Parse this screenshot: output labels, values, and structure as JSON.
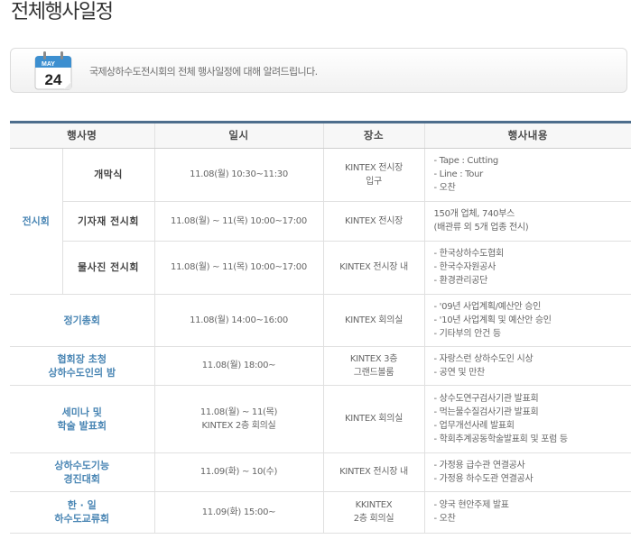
{
  "page": {
    "title": "전체행사일정"
  },
  "notice": {
    "icon_month": "MAY",
    "icon_day": "24",
    "text": "국제상하수도전시회의 전체 행사일정에 대해 알려드립니다."
  },
  "table": {
    "headers": {
      "name": "행사명",
      "date": "일시",
      "place": "장소",
      "content": "행사내용"
    },
    "exhibition": {
      "category": "전시회",
      "rows": [
        {
          "name": "개막식",
          "date": "11.08(월) 10:30~11:30",
          "place": [
            "KINTEX 전시장",
            "입구"
          ],
          "content": [
            "- Tape : Cutting",
            "- Line : Tour",
            "- 오찬"
          ]
        },
        {
          "name": "기자재 전시회",
          "date": "11.08(월) ~ 11(목) 10:00~17:00",
          "place": [
            "KINTEX 전시장"
          ],
          "content": [
            "150개 업체, 740부스",
            "(배관류 외 5개 업종 전시)"
          ]
        },
        {
          "name": "물사진 전시회",
          "date": "11.08(월) ~ 11(목) 10:00~17:00",
          "place": [
            "KINTEX 전시장 내"
          ],
          "content": [
            "- 한국상하수도협회",
            "- 한국수자원공사",
            "- 환경관리공단"
          ]
        }
      ]
    },
    "events": [
      {
        "name": [
          "정기총회"
        ],
        "date": [
          "11.08(월) 14:00~16:00"
        ],
        "place": [
          "KINTEX 회의실"
        ],
        "content": [
          "- '09년 사업계획/예산안 승인",
          "- '10년 사업계획 및 예산안 승인",
          "- 기타부의 안건 등"
        ]
      },
      {
        "name": [
          "협회장 초청",
          "상하수도인의 밤"
        ],
        "date": [
          "11.08(월) 18:00~"
        ],
        "place": [
          "KINTEX 3층",
          "그랜드볼룸"
        ],
        "content": [
          "- 자랑스런 상하수도인 시상",
          "- 공연 및 만찬"
        ]
      },
      {
        "name": [
          "세미나 및",
          "학술 발표회"
        ],
        "date": [
          "11.08(월) ~ 11(목)",
          "KINTEX 2층 회의실"
        ],
        "place": [
          "KINTEX 회의실"
        ],
        "content": [
          "- 상수도연구검사기관 발표회",
          "- 먹는물수질검사기관 발표회",
          "- 업무개선사례 발표회",
          "- 학회추계공동학술발표회 및 포럼 등"
        ]
      },
      {
        "name": [
          "상하수도기능",
          "경진대회"
        ],
        "date": [
          "11.09(화) ~ 10(수)"
        ],
        "place": [
          "KINTEX 전시장 내"
        ],
        "content": [
          "- 가정용 급수관 연결공사",
          "- 가정용 하수도관 연결공사"
        ]
      },
      {
        "name": [
          "한 · 일",
          "하수도교류회"
        ],
        "date": [
          "11.09(화) 15:00~"
        ],
        "place": [
          "KKINTEX",
          "2층 회의실"
        ],
        "content": [
          "- 양국 현안주제 발표",
          "- 오찬"
        ]
      }
    ]
  },
  "colors": {
    "accent": "#4a86b4",
    "header_bar": "#4d6d8c"
  }
}
